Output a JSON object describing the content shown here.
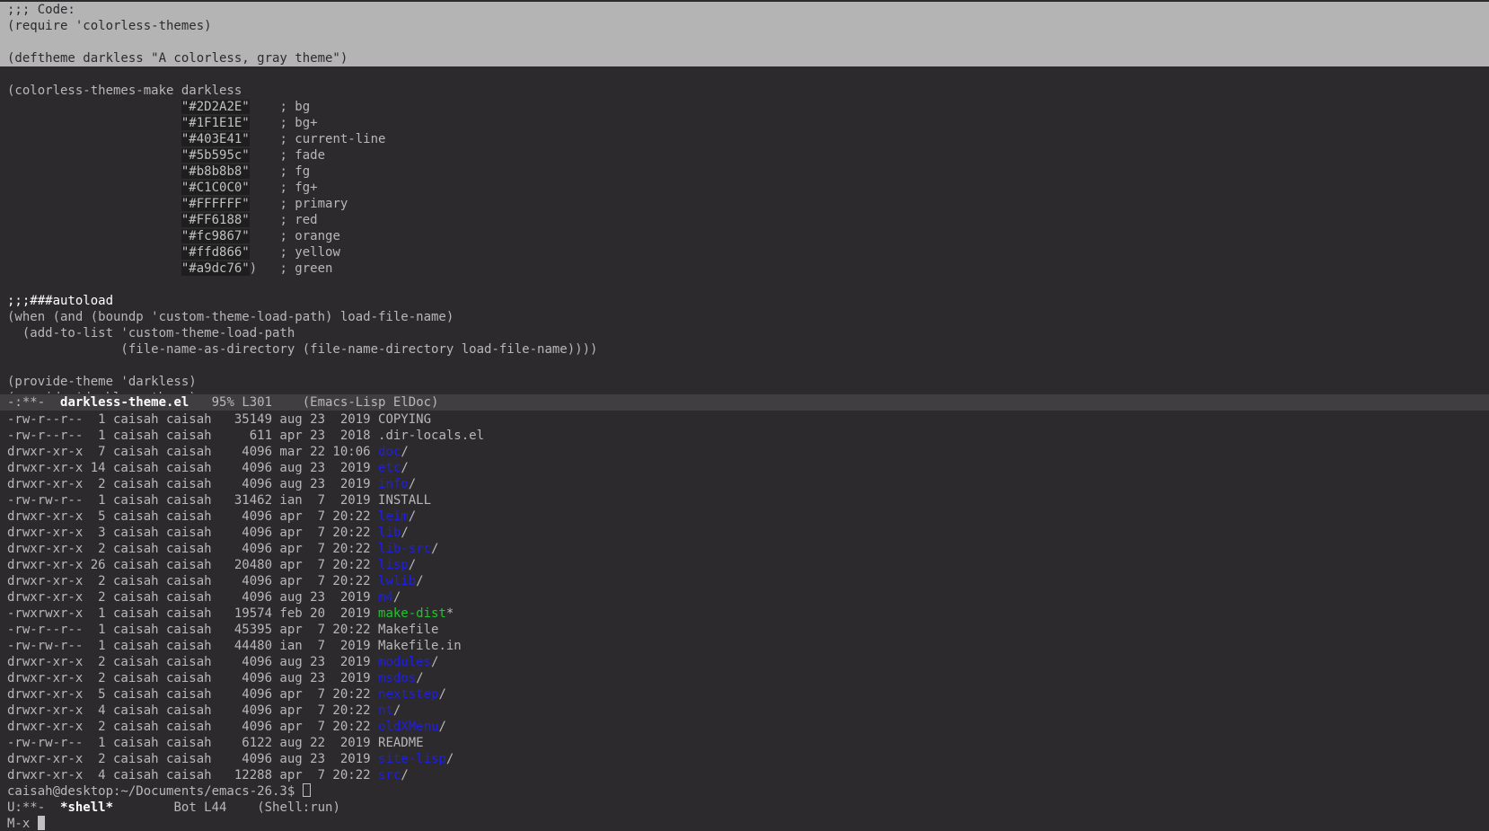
{
  "editor": {
    "lines": [
      {
        "text": ";;; Code:",
        "style": "region"
      },
      {
        "text": "(require 'colorless-themes)",
        "style": "region"
      },
      {
        "text": "",
        "style": "region"
      },
      {
        "text": "(deftheme darkless \"A colorless, gray theme\")",
        "style": "region"
      },
      {
        "text": "",
        "style": "plain"
      },
      {
        "text": "(colorless-themes-make darkless",
        "style": "plain"
      },
      {
        "indent": "                       ",
        "str": "\"#2D2A2E\"",
        "rest": "    ; bg",
        "style": "color"
      },
      {
        "indent": "                       ",
        "str": "\"#1F1E1E\"",
        "rest": "    ; bg+",
        "style": "color"
      },
      {
        "indent": "                       ",
        "str": "\"#403E41\"",
        "rest": "    ; current-line",
        "style": "color"
      },
      {
        "indent": "                       ",
        "str": "\"#5b595c\"",
        "rest": "    ; fade",
        "style": "color"
      },
      {
        "indent": "                       ",
        "str": "\"#b8b8b8\"",
        "rest": "    ; fg",
        "style": "color"
      },
      {
        "indent": "                       ",
        "str": "\"#C1C0C0\"",
        "rest": "    ; fg+",
        "style": "color"
      },
      {
        "indent": "                       ",
        "str": "\"#FFFFFF\"",
        "rest": "    ; primary",
        "style": "color"
      },
      {
        "indent": "                       ",
        "str": "\"#FF6188\"",
        "rest": "    ; red",
        "style": "color"
      },
      {
        "indent": "                       ",
        "str": "\"#fc9867\"",
        "rest": "    ; orange",
        "style": "color"
      },
      {
        "indent": "                       ",
        "str": "\"#ffd866\"",
        "rest": "    ; yellow",
        "style": "color"
      },
      {
        "indent": "                       ",
        "str": "\"#a9dc76\"",
        "rest": ")   ; green",
        "style": "color"
      },
      {
        "text": "",
        "style": "plain"
      },
      {
        "text": ";;;###autoload",
        "style": "bright"
      },
      {
        "text": "(when (and (boundp 'custom-theme-load-path) load-file-name)",
        "style": "plain"
      },
      {
        "text": "  (add-to-list 'custom-theme-load-path",
        "style": "plain"
      },
      {
        "text": "               (file-name-as-directory (file-name-directory load-file-name))))",
        "style": "plain"
      },
      {
        "text": "",
        "style": "plain"
      },
      {
        "text": "(provide-theme 'darkless)",
        "style": "plain"
      },
      {
        "text": "(provide 'darkless-theme)",
        "style": "plain"
      }
    ]
  },
  "modeline_top": {
    "prefix": "-:**-  ",
    "buffer": "darkless-theme.el",
    "position": "   95% L301   ",
    "modes": " (Emacs-Lisp ElDoc)"
  },
  "shell": {
    "listing": [
      {
        "meta": "-rw-r--r--  1 caisah caisah   35149 aug 23  2019 ",
        "name": "COPYING",
        "kind": "file",
        "suffix": ""
      },
      {
        "meta": "-rw-r--r--  1 caisah caisah     611 apr 23  2018 ",
        "name": ".dir-locals.el",
        "kind": "file",
        "suffix": ""
      },
      {
        "meta": "drwxr-xr-x  7 caisah caisah    4096 mar 22 10:06 ",
        "name": "doc",
        "kind": "dir",
        "suffix": "/"
      },
      {
        "meta": "drwxr-xr-x 14 caisah caisah    4096 aug 23  2019 ",
        "name": "etc",
        "kind": "dir",
        "suffix": "/"
      },
      {
        "meta": "drwxr-xr-x  2 caisah caisah    4096 aug 23  2019 ",
        "name": "info",
        "kind": "dir",
        "suffix": "/"
      },
      {
        "meta": "-rw-rw-r--  1 caisah caisah   31462 ian  7  2019 ",
        "name": "INSTALL",
        "kind": "file",
        "suffix": ""
      },
      {
        "meta": "drwxr-xr-x  5 caisah caisah    4096 apr  7 20:22 ",
        "name": "leim",
        "kind": "dir",
        "suffix": "/"
      },
      {
        "meta": "drwxr-xr-x  3 caisah caisah    4096 apr  7 20:22 ",
        "name": "lib",
        "kind": "dir",
        "suffix": "/"
      },
      {
        "meta": "drwxr-xr-x  2 caisah caisah    4096 apr  7 20:22 ",
        "name": "lib-src",
        "kind": "dir",
        "suffix": "/"
      },
      {
        "meta": "drwxr-xr-x 26 caisah caisah   20480 apr  7 20:22 ",
        "name": "lisp",
        "kind": "dir",
        "suffix": "/"
      },
      {
        "meta": "drwxr-xr-x  2 caisah caisah    4096 apr  7 20:22 ",
        "name": "lwlib",
        "kind": "dir",
        "suffix": "/"
      },
      {
        "meta": "drwxr-xr-x  2 caisah caisah    4096 aug 23  2019 ",
        "name": "m4",
        "kind": "dir",
        "suffix": "/"
      },
      {
        "meta": "-rwxrwxr-x  1 caisah caisah   19574 feb 20  2019 ",
        "name": "make-dist",
        "kind": "exe",
        "suffix": "*"
      },
      {
        "meta": "-rw-r--r--  1 caisah caisah   45395 apr  7 20:22 ",
        "name": "Makefile",
        "kind": "file",
        "suffix": ""
      },
      {
        "meta": "-rw-rw-r--  1 caisah caisah   44480 ian  7  2019 ",
        "name": "Makefile.in",
        "kind": "file",
        "suffix": ""
      },
      {
        "meta": "drwxr-xr-x  2 caisah caisah    4096 aug 23  2019 ",
        "name": "modules",
        "kind": "dir",
        "suffix": "/"
      },
      {
        "meta": "drwxr-xr-x  2 caisah caisah    4096 aug 23  2019 ",
        "name": "msdos",
        "kind": "dir",
        "suffix": "/"
      },
      {
        "meta": "drwxr-xr-x  5 caisah caisah    4096 apr  7 20:22 ",
        "name": "nextstep",
        "kind": "dir",
        "suffix": "/"
      },
      {
        "meta": "drwxr-xr-x  4 caisah caisah    4096 apr  7 20:22 ",
        "name": "nt",
        "kind": "dir",
        "suffix": "/"
      },
      {
        "meta": "drwxr-xr-x  2 caisah caisah    4096 apr  7 20:22 ",
        "name": "oldXMenu",
        "kind": "dir",
        "suffix": "/"
      },
      {
        "meta": "-rw-rw-r--  1 caisah caisah    6122 aug 22  2019 ",
        "name": "README",
        "kind": "file",
        "suffix": ""
      },
      {
        "meta": "drwxr-xr-x  2 caisah caisah    4096 aug 23  2019 ",
        "name": "site-lisp",
        "kind": "dir",
        "suffix": "/"
      },
      {
        "meta": "drwxr-xr-x  4 caisah caisah   12288 apr  7 20:22 ",
        "name": "src",
        "kind": "dir",
        "suffix": "/"
      }
    ],
    "prompt": "caisah@desktop:~/Documents/emacs-26.3$ "
  },
  "modeline_bottom": {
    "prefix": "U:**-  ",
    "buffer": "*shell*",
    "position": "        Bot L44    ",
    "modes": "(Shell:run)"
  },
  "minibuffer": {
    "prompt": "M-x "
  },
  "colors": {
    "bg": "#2D2A2E",
    "bg_plus": "#1F1E1E",
    "current_line": "#403E41",
    "fg": "#b8b8b8",
    "directory": "#1f1fe0",
    "executable": "#22c32e"
  }
}
